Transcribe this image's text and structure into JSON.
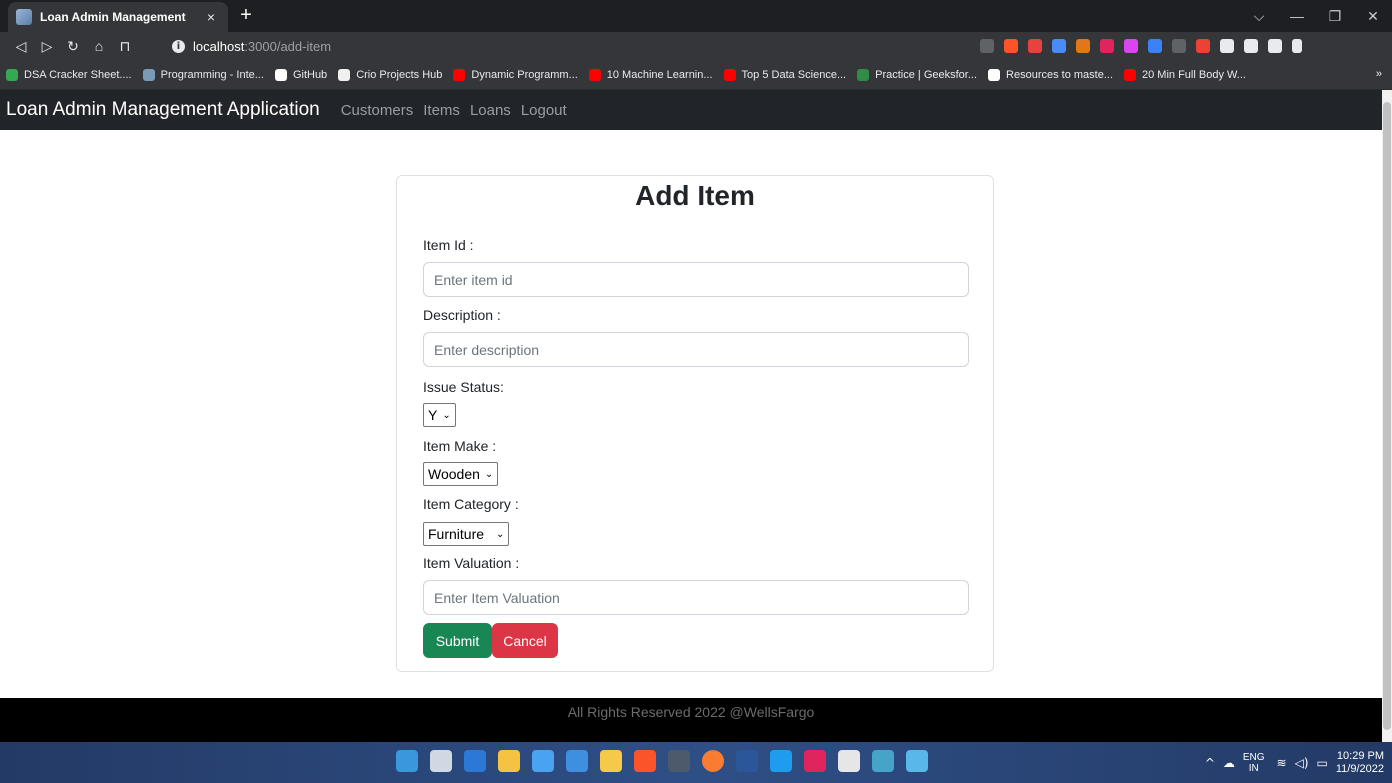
{
  "browser": {
    "tab_title": "Loan Admin Management",
    "tab_close": "×",
    "new_tab": "+",
    "window_controls": {
      "menu": "⌵",
      "minimize": "—",
      "restore": "❐",
      "close": "✕"
    },
    "nav": {
      "back": "◁",
      "forward": "▷",
      "reload": "↻",
      "home": "⌂",
      "bookmark": "⊓"
    },
    "url_host": "localhost",
    "url_path": ":3000/add-item",
    "bookmarks": [
      {
        "label": "DSA Cracker Sheet....",
        "color": "#34a853"
      },
      {
        "label": "Programming - Inte...",
        "color": "#7a9bb8"
      },
      {
        "label": "GitHub",
        "color": "#ffffff"
      },
      {
        "label": "Crio Projects Hub",
        "color": "#f0f0f0"
      },
      {
        "label": "Dynamic Programm...",
        "color": "#ff0000"
      },
      {
        "label": "10 Machine Learnin...",
        "color": "#ff0000"
      },
      {
        "label": "Top 5 Data Science...",
        "color": "#ff0000"
      },
      {
        "label": "Practice | Geeksfor...",
        "color": "#2f8d46"
      },
      {
        "label": "Resources to maste...",
        "color": "#ffffff"
      },
      {
        "label": "20 Min Full Body W...",
        "color": "#ff0000"
      }
    ],
    "bookmarks_more": "»"
  },
  "app": {
    "brand": "Loan Admin Management Application",
    "nav_links": [
      "Customers",
      "Items",
      "Loans",
      "Logout"
    ]
  },
  "form": {
    "title": "Add Item",
    "item_id": {
      "label": "Item Id :",
      "placeholder": "Enter item id"
    },
    "description": {
      "label": "Description :",
      "placeholder": "Enter description"
    },
    "issue_status": {
      "label": "Issue Status:",
      "value": "Y"
    },
    "item_make": {
      "label": "Item Make :",
      "value": "Wooden"
    },
    "item_category": {
      "label": "Item Category :",
      "value": "Furniture"
    },
    "item_valuation": {
      "label": "Item Valuation :",
      "placeholder": "Enter Item Valuation"
    },
    "submit_label": "Submit",
    "cancel_label": "Cancel"
  },
  "footer": {
    "text": "All Rights Reserved 2022 @WellsFargo"
  },
  "taskbar": {
    "lang_primary": "ENG",
    "lang_secondary": "IN",
    "time": "10:29 PM",
    "date": "11/9/2022"
  }
}
